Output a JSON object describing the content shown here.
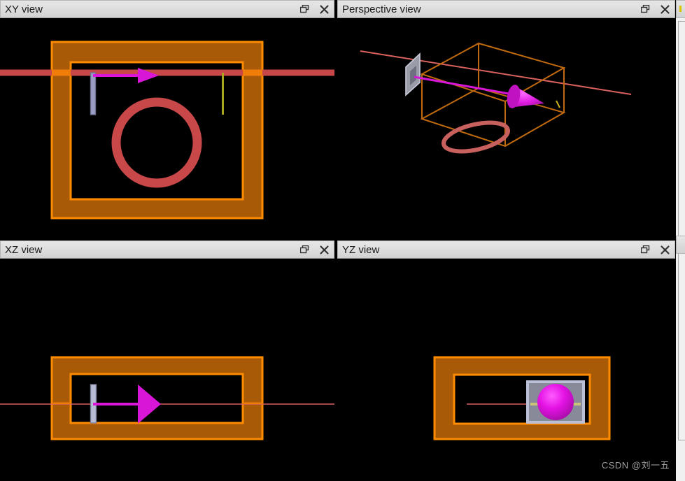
{
  "app": {
    "background_color": "#000000",
    "watermark": "CSDN @刘一五"
  },
  "panels": [
    {
      "id": "xy",
      "title": "XY view",
      "restore_icon": "restore-icon",
      "close_icon": "close-icon"
    },
    {
      "id": "perspective",
      "title": "Perspective view",
      "restore_icon": "restore-icon",
      "close_icon": "close-icon"
    },
    {
      "id": "xz",
      "title": "XZ view",
      "restore_icon": "restore-icon",
      "close_icon": "close-icon"
    },
    {
      "id": "yz",
      "title": "YZ view",
      "restore_icon": "restore-icon",
      "close_icon": "close-icon"
    }
  ],
  "colors": {
    "canvas": "#000000",
    "titlebar": "#dedede",
    "title_text": "#1a1a1a",
    "substrate_fill": "#a85a06",
    "substrate_edge": "#ff8c00",
    "ring_red": "#c8484a",
    "ray_red": "#d9534f",
    "arrow_magenta": "#d816d8",
    "source_gray": "#9a9ec4",
    "plate_gray": "#888a9a",
    "monitor_yellow": "#a8a820",
    "watermark_gray": "#a0a0a0"
  },
  "scene": {
    "xy_view": {
      "substrate_outer": "orange-filled-rectangle",
      "substrate_inner": "black-inner-rectangle",
      "ring": "red-circle-ring",
      "ray": "red-horizontal-ray",
      "arrow": "magenta-source-arrow",
      "source_bar": "gray-source-plate",
      "monitor_bar": "yellow-monitor-line"
    },
    "perspective_view": {
      "box": "orange-wireframe-box",
      "ring": "red-ellipse-ring",
      "ray": "red-diagonal-ray",
      "arrow": "magenta-3d-arrow",
      "source_plate": "gray-source-plate"
    },
    "xz_view": {
      "substrate_outer": "orange-filled-rectangle",
      "substrate_inner": "black-inner-rectangle",
      "ray": "red-horizontal-ray",
      "arrow": "magenta-source-arrow",
      "source_bar": "gray-source-plate"
    },
    "yz_view": {
      "substrate_outer": "orange-filled-rectangle",
      "substrate_inner": "black-inner-rectangle",
      "ray": "red-horizontal-ray",
      "plate": "gray-plate",
      "sphere": "magenta-sphere",
      "monitor_line": "yellow-monitor-line"
    }
  }
}
